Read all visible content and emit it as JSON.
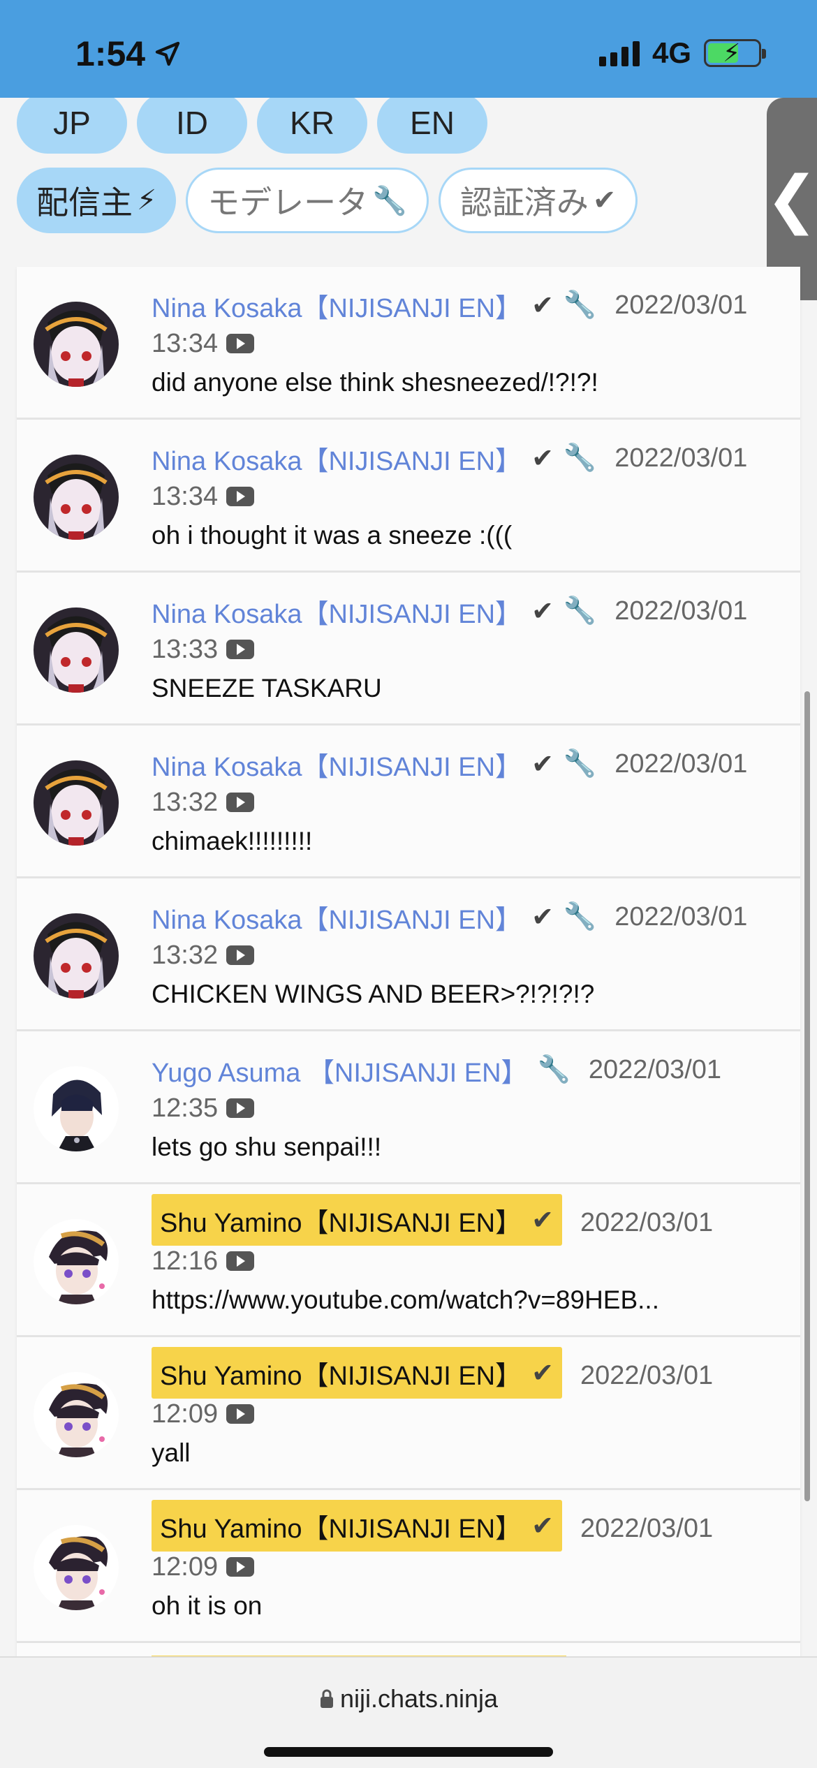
{
  "status_bar": {
    "time": "1:54",
    "network": "4G"
  },
  "language_tabs": [
    "JP",
    "ID",
    "KR",
    "EN"
  ],
  "filters": [
    {
      "label": "配信主",
      "icon": "lightning-icon",
      "glyph": "⚡",
      "active": true
    },
    {
      "label": "モデレータ",
      "icon": "wrench-icon",
      "glyph": "🔧",
      "active": false
    },
    {
      "label": "認証済み",
      "icon": "check-icon",
      "glyph": "✔",
      "active": false
    }
  ],
  "side_tab": {
    "glyph": "❮"
  },
  "messages": [
    {
      "author": "Nina Kosaka【NIJISANJI EN】",
      "verified": true,
      "moderator": true,
      "owner": false,
      "date": "2022/03/01",
      "time": "13:34",
      "text": "did anyone else think shesneezed/!?!?!",
      "avatar": "nina"
    },
    {
      "author": "Nina Kosaka【NIJISANJI EN】",
      "verified": true,
      "moderator": true,
      "owner": false,
      "date": "2022/03/01",
      "time": "13:34",
      "text": "oh i thought it was a sneeze :(((",
      "avatar": "nina"
    },
    {
      "author": "Nina Kosaka【NIJISANJI EN】",
      "verified": true,
      "moderator": true,
      "owner": false,
      "date": "2022/03/01",
      "time": "13:33",
      "text": "SNEEZE TASKARU",
      "avatar": "nina"
    },
    {
      "author": "Nina Kosaka【NIJISANJI EN】",
      "verified": true,
      "moderator": true,
      "owner": false,
      "date": "2022/03/01",
      "time": "13:32",
      "text": "chimaek!!!!!!!!!",
      "avatar": "nina"
    },
    {
      "author": "Nina Kosaka【NIJISANJI EN】",
      "verified": true,
      "moderator": true,
      "owner": false,
      "date": "2022/03/01",
      "time": "13:32",
      "text": "CHICKEN WINGS AND BEER>?!?!?!?",
      "avatar": "nina"
    },
    {
      "author": "Yugo Asuma 【NIJISANJI EN】",
      "verified": false,
      "moderator": true,
      "owner": false,
      "date": "2022/03/01",
      "time": "12:35",
      "text": "lets go shu senpai!!!",
      "avatar": "yugo"
    },
    {
      "author": "Shu Yamino【NIJISANJI EN】",
      "verified": true,
      "moderator": false,
      "owner": true,
      "date": "2022/03/01",
      "time": "12:16",
      "text": "https://www.youtube.com/watch?v=89HEB...",
      "avatar": "shu"
    },
    {
      "author": "Shu Yamino【NIJISANJI EN】",
      "verified": true,
      "moderator": false,
      "owner": true,
      "date": "2022/03/01",
      "time": "12:09",
      "text": "yall",
      "avatar": "shu"
    },
    {
      "author": "Shu Yamino【NIJISANJI EN】",
      "verified": true,
      "moderator": false,
      "owner": true,
      "date": "2022/03/01",
      "time": "12:09",
      "text": "oh it is on",
      "avatar": "shu"
    }
  ],
  "browser": {
    "url": "niji.chats.ninja"
  }
}
